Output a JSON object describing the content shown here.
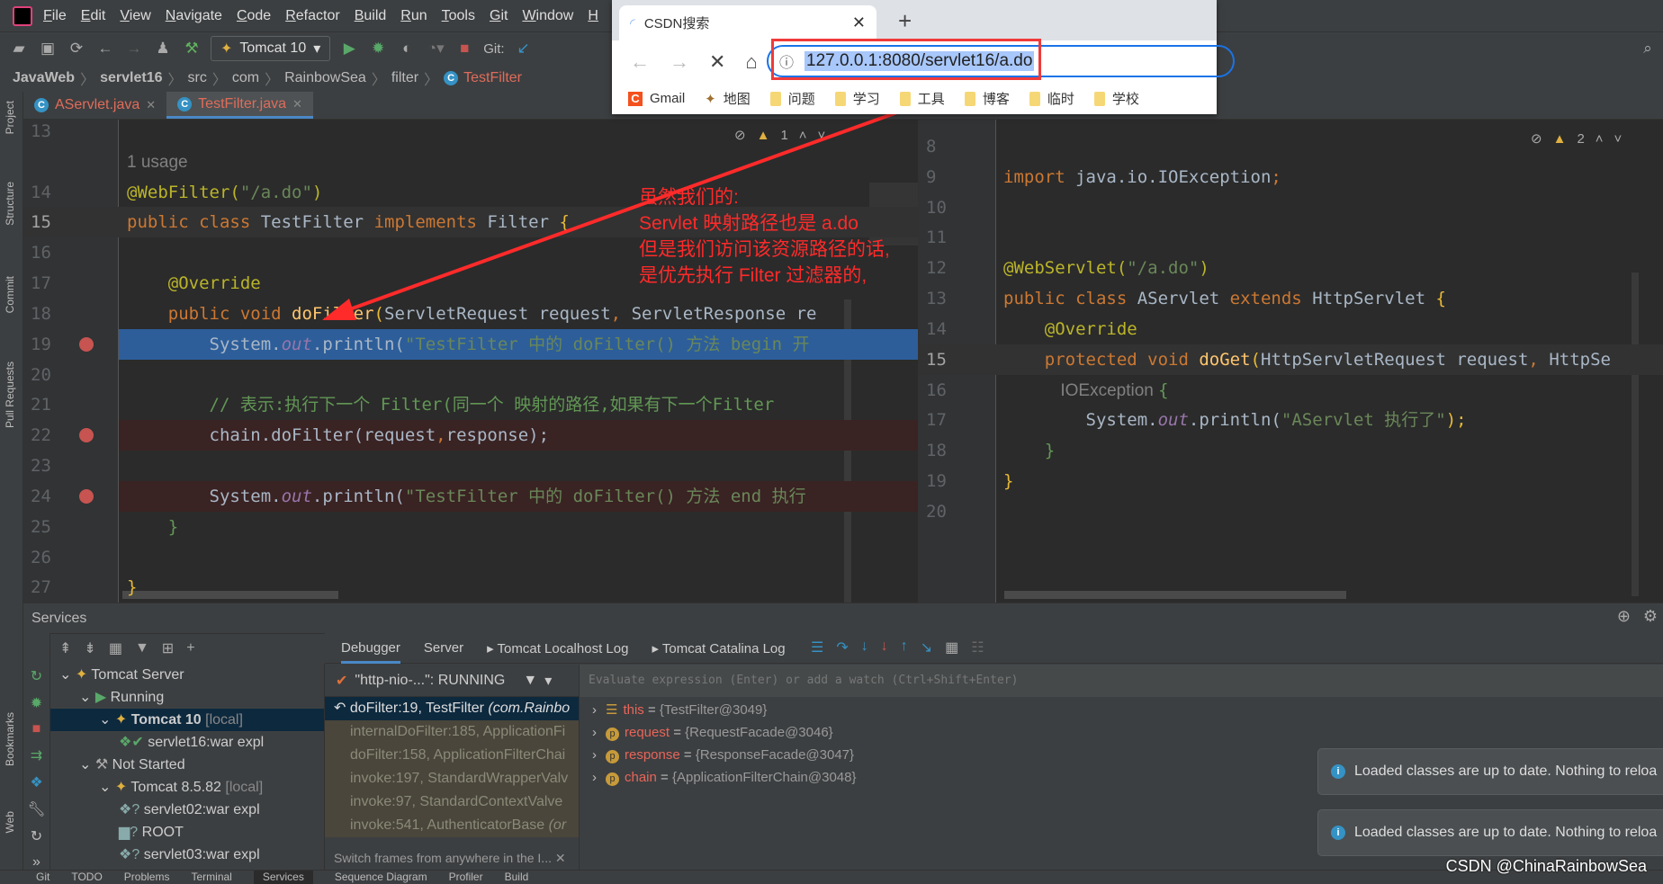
{
  "ide": {
    "menu": [
      "File",
      "Edit",
      "View",
      "Navigate",
      "Code",
      "Refactor",
      "Build",
      "Run",
      "Tools",
      "Git",
      "Window",
      "H"
    ],
    "run_config": "Tomcat 10",
    "git_label": "Git:",
    "breadcrumb": [
      "JavaWeb",
      "servlet16",
      "src",
      "com",
      "RainbowSea",
      "filter",
      "TestFilter"
    ],
    "tabs": [
      {
        "label": "AServlet.java",
        "active": false
      },
      {
        "label": "TestFilter.java",
        "active": true
      }
    ],
    "left_strip": [
      "Project",
      "Structure",
      "Commit",
      "Pull Requests",
      "Bookmarks",
      "Web"
    ]
  },
  "left_editor": {
    "warnings": "1",
    "lines": [
      {
        "n": "13",
        "tokens": []
      },
      {
        "n": "",
        "tokens": [
          [
            "1 usage",
            "hint"
          ]
        ]
      },
      {
        "n": "14",
        "tokens": [
          [
            "@WebFilter(",
            "ann"
          ],
          [
            "\"/a.do\"",
            "str"
          ],
          [
            ")",
            "ann"
          ]
        ]
      },
      {
        "n": "15",
        "tokens": [
          [
            "public class ",
            "kw"
          ],
          [
            "TestFilter ",
            "tx"
          ],
          [
            "implements ",
            "kw"
          ],
          [
            "Filter ",
            "tx"
          ],
          [
            "{",
            "br"
          ]
        ],
        "hl": "cur"
      },
      {
        "n": "16",
        "tokens": []
      },
      {
        "n": "17",
        "tokens": [
          [
            "    @Override",
            "ann"
          ]
        ]
      },
      {
        "n": "18",
        "tokens": [
          [
            "    public void ",
            "kw"
          ],
          [
            "doFilter",
            "fn"
          ],
          [
            "(",
            "br"
          ],
          [
            "ServletRequest request",
            "tx"
          ],
          [
            ", ",
            "kw"
          ],
          [
            "ServletResponse re",
            "tx"
          ]
        ]
      },
      {
        "n": "19",
        "tokens": [
          [
            "        System.",
            "tx"
          ],
          [
            "out",
            "st"
          ],
          [
            ".println(",
            "tx"
          ],
          [
            "\"TestFilter 中的 doFilter() 方法 begin 开",
            "str"
          ]
        ],
        "hl": "blue",
        "bp": true
      },
      {
        "n": "20",
        "tokens": []
      },
      {
        "n": "21",
        "tokens": [
          [
            "        // 表示:执行下一个 Filter(同一个 映射的路径,如果有下一个Filter",
            "cm"
          ]
        ]
      },
      {
        "n": "22",
        "tokens": [
          [
            "        chain.doFilter(request",
            "tx"
          ],
          [
            ",",
            "kw"
          ],
          [
            "response);",
            "tx"
          ]
        ],
        "hl": "red",
        "bp": true
      },
      {
        "n": "23",
        "tokens": []
      },
      {
        "n": "24",
        "tokens": [
          [
            "        System.",
            "tx"
          ],
          [
            "out",
            "st"
          ],
          [
            ".println(",
            "tx"
          ],
          [
            "\"TestFilter 中的 doFilter() 方法 end 执行",
            "str"
          ]
        ],
        "hl": "red",
        "bp": true
      },
      {
        "n": "25",
        "tokens": [
          [
            "    }",
            "cm"
          ]
        ]
      },
      {
        "n": "26",
        "tokens": []
      },
      {
        "n": "27",
        "tokens": [
          [
            "}",
            "br"
          ]
        ]
      }
    ]
  },
  "right_editor": {
    "warnings": "2",
    "lines": [
      {
        "n": "8",
        "tokens": []
      },
      {
        "n": "9",
        "tokens": [
          [
            "import ",
            "kw"
          ],
          [
            "java.io.IOException",
            "tx"
          ],
          [
            ";",
            "kw"
          ]
        ]
      },
      {
        "n": "10",
        "tokens": []
      },
      {
        "n": "11",
        "tokens": []
      },
      {
        "n": "12",
        "tokens": [
          [
            "@WebServlet(",
            "ann"
          ],
          [
            "\"/a.do\"",
            "str"
          ],
          [
            ")",
            "ann"
          ]
        ]
      },
      {
        "n": "13",
        "tokens": [
          [
            "public class ",
            "kw"
          ],
          [
            "AServlet ",
            "tx"
          ],
          [
            "extends ",
            "kw"
          ],
          [
            "HttpServlet ",
            "tx"
          ],
          [
            "{",
            "br"
          ]
        ]
      },
      {
        "n": "14",
        "tokens": [
          [
            "    @Override",
            "ann"
          ]
        ]
      },
      {
        "n": "15",
        "tokens": [
          [
            "    protected void ",
            "kw"
          ],
          [
            "doGet",
            "fn"
          ],
          [
            "(",
            "br"
          ],
          [
            "HttpServletRequest request",
            "tx"
          ],
          [
            ", ",
            "kw"
          ],
          [
            "HttpSe",
            "tx"
          ]
        ],
        "hl": "cur"
      },
      {
        "n": "16",
        "tokens": [
          [
            "            IOException ",
            "hint"
          ],
          [
            "{",
            "cm"
          ]
        ]
      },
      {
        "n": "17",
        "tokens": [
          [
            "        System.",
            "tx"
          ],
          [
            "out",
            "st"
          ],
          [
            ".println(",
            "tx"
          ],
          [
            "\"AServlet 执行了\"",
            "str"
          ],
          [
            ");",
            "br"
          ]
        ]
      },
      {
        "n": "18",
        "tokens": [
          [
            "    }",
            "cm"
          ]
        ]
      },
      {
        "n": "19",
        "tokens": [
          [
            "}",
            "br"
          ]
        ]
      },
      {
        "n": "20",
        "tokens": []
      }
    ]
  },
  "annotation": {
    "lines": [
      "虽然我们的:",
      "Servlet 映射路径也是 a.do",
      "但是我们访问该资源路径的话,",
      "是优先执行 Filter 过滤器的,"
    ],
    "color": "#ff2a2a"
  },
  "browser": {
    "tab_title": "CSDN搜索",
    "url": "127.0.0.1:8080/servlet16/a.do",
    "bookmarks": [
      "Gmail",
      "地图",
      "问题",
      "学习",
      "工具",
      "博客",
      "临时",
      "学校"
    ]
  },
  "services": {
    "title": "Services",
    "tree": [
      {
        "label": "Tomcat Server",
        "dim": "",
        "indent": 0,
        "icon": "tomcat"
      },
      {
        "label": "Running",
        "dim": "",
        "indent": 1,
        "icon": "run"
      },
      {
        "label": "Tomcat 10",
        "dim": " [local]",
        "indent": 2,
        "icon": "tomcat",
        "selected": true
      },
      {
        "label": "servlet16:war expl",
        "dim": "",
        "indent": 3,
        "icon": "artifact-ok"
      },
      {
        "label": "Not Started",
        "dim": "",
        "indent": 1,
        "icon": "wrench"
      },
      {
        "label": "Tomcat 8.5.82",
        "dim": " [local]",
        "indent": 2,
        "icon": "tomcat"
      },
      {
        "label": "servlet02:war expl",
        "dim": "",
        "indent": 3,
        "icon": "artifact-unknown"
      },
      {
        "label": "ROOT",
        "dim": "",
        "indent": 3,
        "icon": "folder-unknown"
      },
      {
        "label": "servlet03:war expl",
        "dim": "",
        "indent": 3,
        "icon": "artifact-unknown"
      }
    ],
    "debug_tabs": [
      "Debugger",
      "Server",
      "Tomcat Localhost Log",
      "Tomcat Catalina Log"
    ],
    "thread": "\"http-nio-...\": RUNNING",
    "frames": [
      {
        "text": "doFilter:19, TestFilter ",
        "italic": "(com.Rainbo",
        "selected": true
      },
      {
        "text": "internalDoFilter:185, ApplicationFi",
        "italic": ""
      },
      {
        "text": "doFilter:158, ApplicationFilterChai",
        "italic": ""
      },
      {
        "text": "invoke:197, StandardWrapperValv",
        "italic": ""
      },
      {
        "text": "invoke:97, StandardContextValve",
        "italic": ""
      },
      {
        "text": "invoke:541, AuthenticatorBase ",
        "italic": "(or"
      }
    ],
    "frames_hint": "Switch frames from anywhere in the I...",
    "eval_placeholder": "Evaluate expression (Enter) or add a watch (Ctrl+Shift+Enter)",
    "variables": [
      {
        "name": "this",
        "value": "{TestFilter@3049}",
        "icon": "object"
      },
      {
        "name": "request",
        "value": "{RequestFacade@3046}",
        "icon": "p"
      },
      {
        "name": "response",
        "value": "{ResponseFacade@3047}",
        "icon": "p"
      },
      {
        "name": "chain",
        "value": "{ApplicationFilterChain@3048}",
        "icon": "p"
      }
    ],
    "notifications": [
      "Loaded classes are up to date. Nothing to reloa",
      "Loaded classes are up to date. Nothing to reloa"
    ]
  },
  "statusbar": [
    "Git",
    "TODO",
    "Problems",
    "Terminal",
    "Services",
    "Sequence Diagram",
    "Profiler",
    "Build"
  ],
  "statusbar_active": "Services",
  "watermark": "CSDN @ChinaRainbowSea"
}
